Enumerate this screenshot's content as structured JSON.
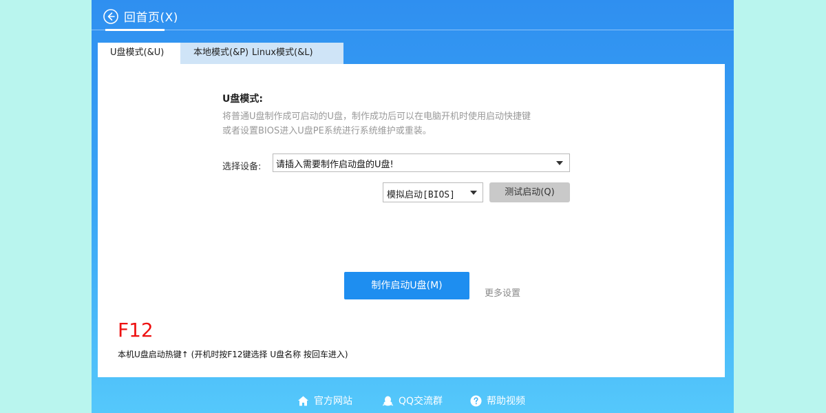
{
  "header": {
    "home_label": "回首页(X)"
  },
  "tabs": [
    {
      "label": "U盘模式(&U)",
      "active": true
    },
    {
      "label": "本地模式(&P)",
      "active": false
    },
    {
      "label": "Linux模式(&L)",
      "active": false
    }
  ],
  "panel": {
    "mode_title": "U盘模式:",
    "desc_line1": "将普通U盘制作成可启动的U盘，制作成功后可以在电脑开机时使用启动快捷键",
    "desc_line2": "或者设置BIOS进入U盘PE系统进行系统维护或重装。",
    "device_label": "选择设备:",
    "device_value": "请插入需要制作启动盘的U盘!",
    "boot_mode_value": "模拟启动[BIOS]",
    "test_button": "测试启动(Q)",
    "make_button": "制作启动U盘(M)",
    "more_settings": "更多设置",
    "hotkey": "F12",
    "hotkey_note": "本机U盘启动热键↑ (开机时按F12键选择 U盘名称 按回车进入)"
  },
  "footer": {
    "site": "官方网站",
    "qq": "QQ交流群",
    "help": "帮助视频"
  },
  "colors": {
    "accent": "#1e8ef0",
    "hotkey": "#ee1111",
    "background": "#b9f5ee"
  }
}
